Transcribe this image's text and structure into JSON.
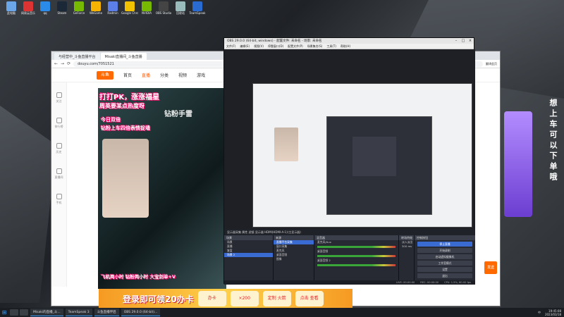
{
  "desktop": {
    "icons": [
      {
        "label": "此电脑",
        "color": "#6aa6e8"
      },
      {
        "label": "网易云音乐",
        "color": "#d33"
      },
      {
        "label": "qq",
        "color": "#2a8ce8"
      },
      {
        "label": "Steam",
        "color": "#1b2838"
      },
      {
        "label": "GeForce",
        "color": "#76b900"
      },
      {
        "label": "WeGame",
        "color": "#f6b400"
      },
      {
        "label": "Radmin",
        "color": "#5b7ee8"
      },
      {
        "label": "Google Chrome",
        "color": "#f2c200"
      },
      {
        "label": "NVIDIA",
        "color": "#76b900"
      },
      {
        "label": "OBS Studio",
        "color": "#444"
      },
      {
        "label": "回收站",
        "color": "#9bb"
      },
      {
        "label": "TeamSpeak",
        "color": "#2a6bd2"
      }
    ]
  },
  "side_vertical_text": "想上车可以下单哦",
  "browser": {
    "tabs": [
      {
        "label": "与经营中_斗鱼直播平台",
        "active": false
      },
      {
        "label": "Misaki直播间_斗鱼直播",
        "active": true
      }
    ],
    "url": "douyu.com/7051521",
    "translate_btn": "翻译此页",
    "site_nav": {
      "logo": "斗鱼",
      "items": [
        "首页",
        "直播",
        "分类",
        "视频",
        "游戏"
      ]
    },
    "rail_items": [
      "关注",
      "排行榜",
      "历史",
      "直播间",
      "手机"
    ],
    "overlay_lines": [
      "打打PK，涨涨福星",
      "周英要某点热度呀",
      "钻粉手雷",
      "今日双倍",
      "钻粉上车四倍表情捉墙"
    ],
    "overlay_bottom": "飞机两小时  钻粉两小时  大宝剑单+V",
    "ad_text": "登录即可领20办卡",
    "ad_prizes": [
      "办卡",
      "×200",
      "定制 火箭",
      "点击 查看"
    ],
    "right_btn": "发送"
  },
  "obs": {
    "title": "OBS 29.0.0 (64-bit, windows) - 配置文件: 未命名 - 场景: 未命名",
    "menu": [
      "文件(F)",
      "编辑(E)",
      "视图(V)",
      "停靠窗口(D)",
      "配置文件(P)",
      "场景集合(S)",
      "工具(T)",
      "帮助(H)"
    ],
    "control_bar": "显示器采集   属性   滤镜   显示器  HDMI(HDMI-A-1)(主显示器)",
    "docks": {
      "scenes": {
        "title": "场景",
        "items": [
          "场景",
          "直播",
          "复盘",
          "场景 2"
        ]
      },
      "sources": {
        "title": "来源",
        "items": [
          "直播平台采集",
          "窗口采集",
          "麦克风",
          "桌面音频",
          "图像"
        ]
      },
      "mixer": {
        "title": "混音器",
        "items": [
          "麦克风/Aux",
          "桌面音频",
          "桌面音频 2"
        ]
      },
      "transitions": {
        "title": "转场特效",
        "items": [
          "淡入淡出",
          "300 ms"
        ]
      },
      "controls": {
        "title": "控制按钮",
        "buttons": [
          "停止直播",
          "开始录制",
          "启动虚拟摄像机",
          "工作室模式",
          "设置",
          "退出"
        ]
      }
    },
    "status": {
      "live": "LIVE: 00:00:00",
      "rec": "REC: 00:00:00",
      "cpu": "CPU: 1.5%, 60.00 fps"
    }
  },
  "taskbar": {
    "tasks": [
      "Misaki的直播_斗...",
      "TeamSpeak 3",
      "斗鱼直播伴侣",
      "OBS 29.0.0 (64-bit)..."
    ],
    "tray": "中",
    "time": "19:45:08",
    "date": "2023/03/18"
  }
}
